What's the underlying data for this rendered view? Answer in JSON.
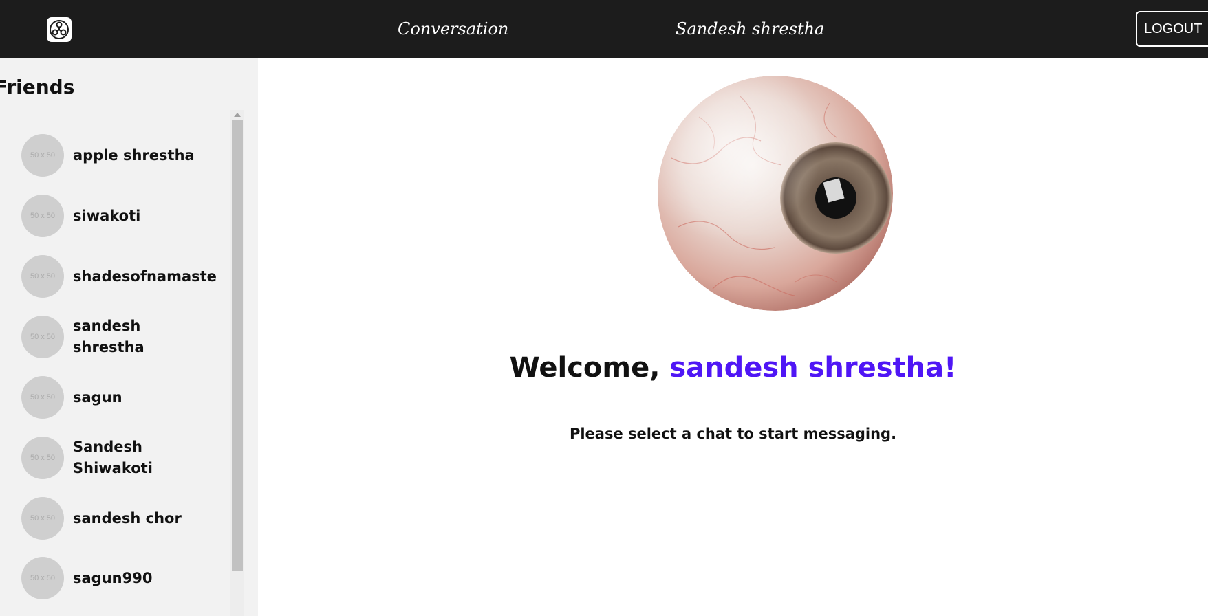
{
  "header": {
    "nav_conversation": "Conversation",
    "current_user": "Sandesh shrestha",
    "logout_label": "LOGOUT"
  },
  "sidebar": {
    "title": "Friends",
    "friends": [
      {
        "name": "apple shrestha",
        "avatar_placeholder": "50 x 50"
      },
      {
        "name": "siwakoti",
        "avatar_placeholder": "50 x 50"
      },
      {
        "name": "shadesofnamaste",
        "avatar_placeholder": "50 x 50"
      },
      {
        "name": "sandesh shrestha",
        "avatar_placeholder": "50 x 50"
      },
      {
        "name": "sagun",
        "avatar_placeholder": "50 x 50"
      },
      {
        "name": "Sandesh Shiwakoti",
        "avatar_placeholder": "50 x 50"
      },
      {
        "name": "sandesh chor",
        "avatar_placeholder": "50 x 50"
      },
      {
        "name": "sagun990",
        "avatar_placeholder": "50 x 50"
      }
    ]
  },
  "main": {
    "welcome_prefix": "Welcome, ",
    "welcome_name": "sandesh shrestha!",
    "hint": "Please select a chat to start messaging.",
    "illustration": "eyeball-illustration"
  },
  "colors": {
    "topbar": "#1c1c1c",
    "sidebar": "#f2f2f2",
    "accent_name": "#4f16f5"
  }
}
